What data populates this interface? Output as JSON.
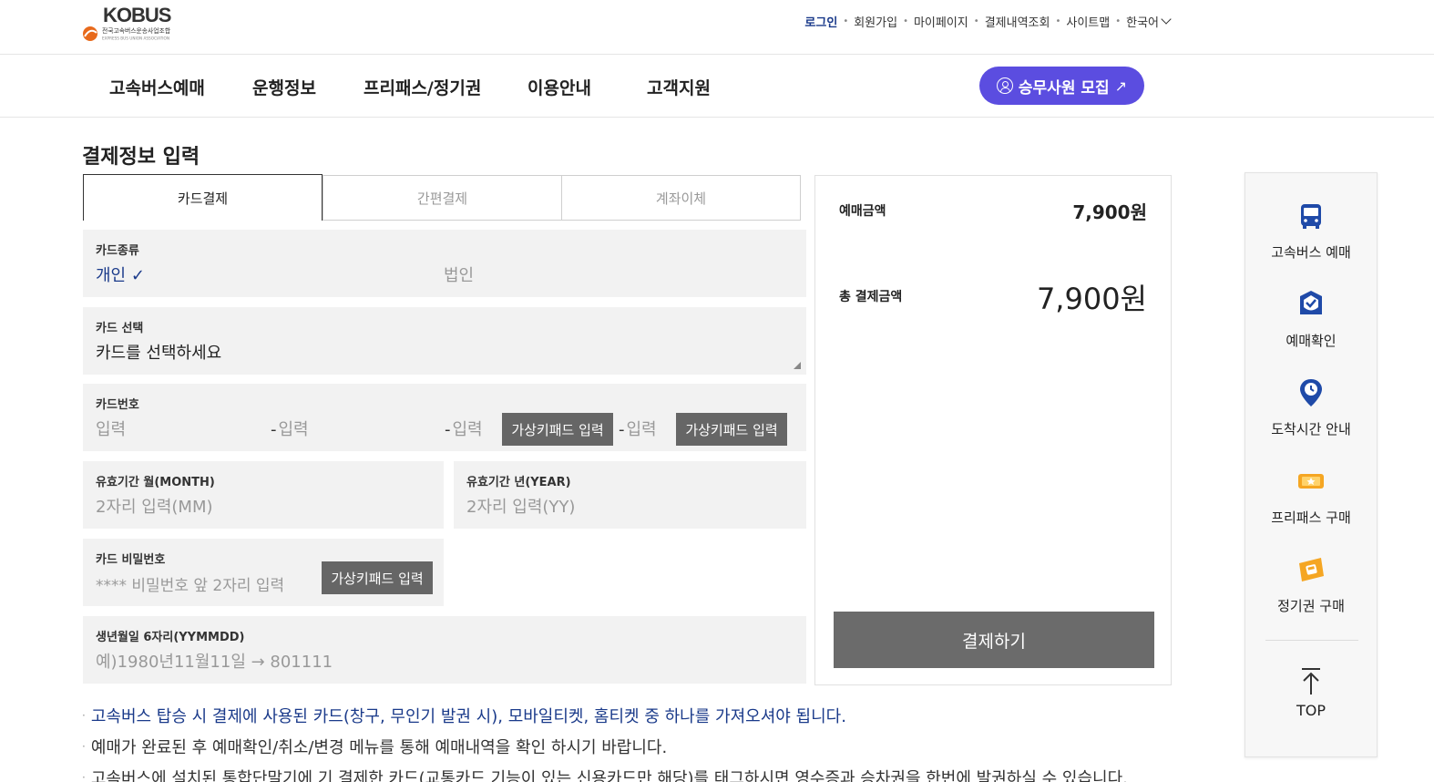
{
  "brand": {
    "logo_text": "KOBUS",
    "logo_sub": "전국고속버스운송사업조합",
    "logo_sub_en": "EXPRESS BUS UNION ASSOCIATION"
  },
  "util_nav": [
    "로그인",
    "회원가입",
    "마이페이지",
    "결제내역조회",
    "사이트맵",
    "한국어"
  ],
  "main_nav": [
    "고속버스예매",
    "운행정보",
    "프리패스/정기권",
    "이용안내",
    "고객지원"
  ],
  "recruit_button": "승무사원 모집",
  "page_title": "결제정보 입력",
  "tabs": [
    "카드결제",
    "간편결제",
    "계좌이체"
  ],
  "form": {
    "card_type": {
      "label": "카드종류",
      "personal": "개인",
      "corporate": "법인"
    },
    "card_select": {
      "label": "카드 선택",
      "value": "카드를 선택하세요"
    },
    "card_number": {
      "label": "카드번호",
      "placeholder": "입력",
      "keypad_label": "가상키패드 입력"
    },
    "expiry_month": {
      "label": "유효기간 월(MONTH)",
      "placeholder": "2자리 입력(MM)"
    },
    "expiry_year": {
      "label": "유효기간 년(YEAR)",
      "placeholder": "2자리 입력(YY)"
    },
    "card_password": {
      "label": "카드 비밀번호",
      "placeholder": "**** 비밀번호 앞 2자리 입력",
      "keypad_label": "가상키패드 입력"
    },
    "birth": {
      "label": "생년월일 6자리(YYMMDD)",
      "placeholder": "예)1980년11월11일 → 801111"
    }
  },
  "summary": {
    "booking_amount_label": "예매금액",
    "booking_amount": "7,900원",
    "total_label": "총 결제금액",
    "total_amount": "7,900원",
    "pay_button": "결제하기"
  },
  "notices": [
    "고속버스 탑승 시 결제에 사용된 카드(창구, 무인기 발권 시), 모바일티켓, 홈티켓 중 하나를 가져오셔야 됩니다.",
    "예매가 완료된 후 예매확인/취소/변경 메뉴를 통해 예매내역을 확인 하시기 바랍니다.",
    "고속버스에 설치된 통합단말기에 기 결제한 카드(교통카드 기능이 있는 신용카드만 해당)를 태그하시면 영수증과 승차권을 한번에 발권하실 수 있습니다."
  ],
  "quick_menu": [
    "고속버스 예매",
    "예매확인",
    "도착시간 안내",
    "프리패스 구매",
    "정기권 구매"
  ],
  "quick_top": "TOP",
  "colors": {
    "accent_purple": "#5b4de0",
    "navy": "#1a3a8a",
    "pay_gray": "#6b6b6b",
    "icon_blue": "#1f4aa8",
    "icon_orange": "#f5a623"
  }
}
